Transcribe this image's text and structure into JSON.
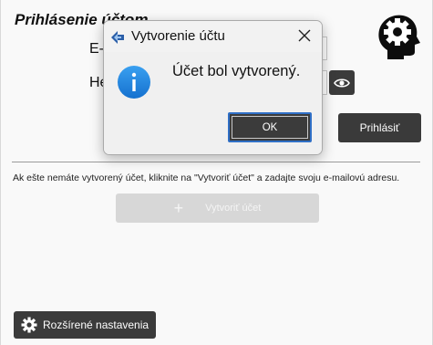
{
  "login": {
    "section_title": "Prihlásenie účtom",
    "email_label": "E-",
    "password_label": "He",
    "login_button": "Prihlásiť"
  },
  "register": {
    "hint": "Ak ešte nemáte vytvorený účet, kliknite na \"Vytvoriť účet\" a zadajte svoju e-mailovú adresu.",
    "create_icon": "+",
    "create_button": "Vytvoriť účet"
  },
  "footer": {
    "advanced_button": "Rozšírené nastavenia"
  },
  "dialog": {
    "title": "Vytvorenie účtu",
    "message": "Účet bol vytvorený.",
    "ok_button": "OK",
    "close_glyph": "✕"
  },
  "icons": {
    "head": "head-gear-icon",
    "eye": "eye-icon",
    "gear": "gear-icon",
    "info": "info-icon",
    "app": "app-icon"
  },
  "colors": {
    "dark_button": "#3b3b3b",
    "disabled_button": "#d7d7d7",
    "info_blue": "#1e86e0",
    "focus_border": "#2f6fc6"
  }
}
